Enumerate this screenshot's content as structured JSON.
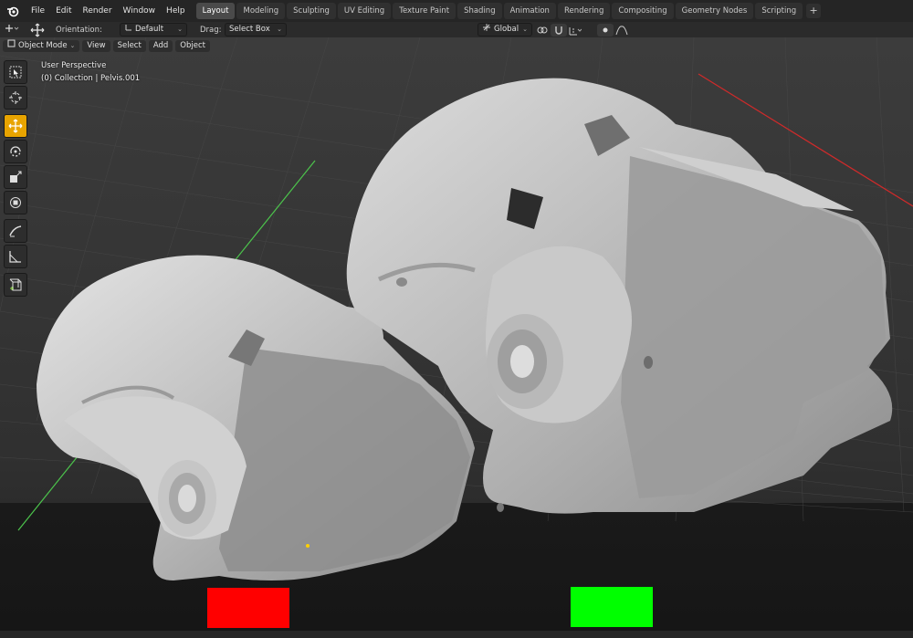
{
  "topbar": {
    "menus": [
      "File",
      "Edit",
      "Render",
      "Window",
      "Help"
    ],
    "workspaces": [
      "Layout",
      "Modeling",
      "Sculpting",
      "UV Editing",
      "Texture Paint",
      "Shading",
      "Animation",
      "Rendering",
      "Compositing",
      "Geometry Nodes",
      "Scripting"
    ],
    "active_workspace": "Layout",
    "add_tab": "+"
  },
  "tool_settings": {
    "orientation_label": "Orientation:",
    "orientation_value": "Default",
    "drag_label": "Drag:",
    "drag_value": "Select Box",
    "transform_orientation": "Global"
  },
  "viewport_header": {
    "mode": "Object Mode",
    "menus": [
      "View",
      "Select",
      "Add",
      "Object"
    ]
  },
  "viewport": {
    "view_name": "User Perspective",
    "collection_info": "(0) Collection | Pelvis.001"
  },
  "toolbar": {
    "tools": [
      "select-box",
      "cursor",
      "move",
      "rotate",
      "scale",
      "transform",
      "annotate",
      "measure",
      "add-cube"
    ],
    "active_tool": "move"
  },
  "markers": {
    "left_color": "#ff0000",
    "right_color": "#00ff00"
  },
  "colors": {
    "accent": "#e8a400",
    "x_axis": "#d02a2a",
    "y_axis": "#4cc44c"
  }
}
